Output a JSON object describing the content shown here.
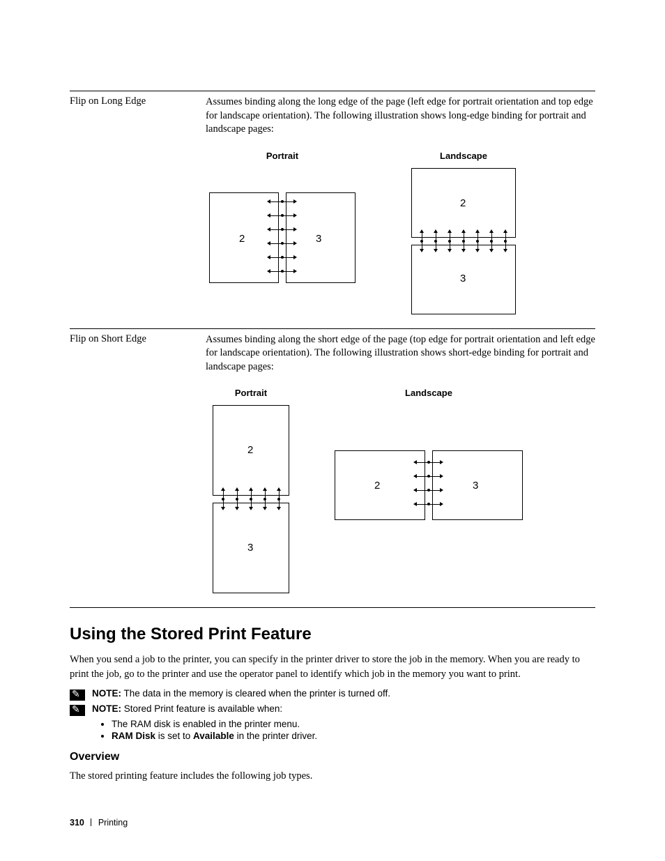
{
  "row1": {
    "label": "Flip on Long Edge",
    "desc": "Assumes binding along the long edge of the page (left edge for portrait orientation and top edge for landscape orientation). The following illustration shows long-edge binding for portrait and landscape pages:",
    "portrait": "Portrait",
    "landscape": "Landscape",
    "n2": "2",
    "n3": "3"
  },
  "row2": {
    "label": "Flip on Short Edge",
    "desc": "Assumes binding along the short edge of the page (top edge for portrait orientation and left edge for landscape orientation). The following illustration shows short-edge binding for portrait and landscape pages:",
    "portrait": "Portrait",
    "landscape": "Landscape",
    "n2": "2",
    "n3": "3"
  },
  "heading": "Using the Stored Print Feature",
  "body": "When you send a job to the printer, you can specify in the printer driver to store the job in the memory. When you are ready to print the job, go to the printer and use the operator panel to identify which job in the memory you want to print.",
  "notes": {
    "label": "NOTE:",
    "n1": "The data in the memory is cleared when the printer is turned off.",
    "n2": "Stored Print feature is available when:"
  },
  "bullets": {
    "b1": "The RAM disk is enabled in the printer menu.",
    "b2_pre": "RAM Disk",
    "b2_mid": " is set to ",
    "b2_bold": "Available",
    "b2_post": " in the printer driver."
  },
  "subhead": "Overview",
  "body2": "The stored printing feature includes the following job types.",
  "footer": {
    "page": "310",
    "section": "Printing"
  }
}
